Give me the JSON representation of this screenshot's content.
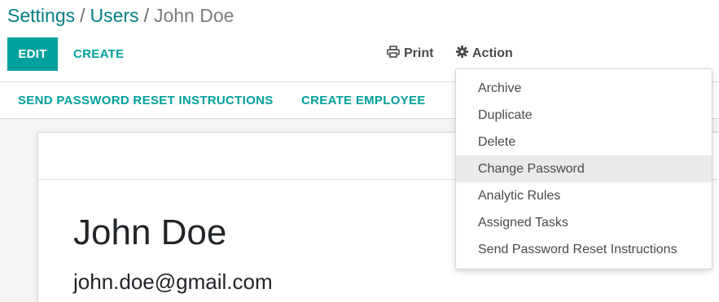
{
  "breadcrumb": {
    "items": [
      "Settings",
      "Users"
    ],
    "separator": "/",
    "current": "John Doe"
  },
  "toolbar": {
    "edit_label": "EDIT",
    "create_label": "CREATE",
    "print_label": "Print",
    "action_label": "Action"
  },
  "statusbar": {
    "buttons": [
      "SEND PASSWORD RESET INSTRUCTIONS",
      "CREATE EMPLOYEE"
    ]
  },
  "action_menu": {
    "items": [
      "Archive",
      "Duplicate",
      "Delete",
      "Change Password",
      "Analytic Rules",
      "Assigned Tasks",
      "Send Password Reset Instructions"
    ],
    "highlighted": "Change Password"
  },
  "form": {
    "name": "John Doe",
    "email": "john.doe@gmail.com"
  },
  "colors": {
    "primary": "#00a09d",
    "link": "#017e84",
    "text": "#212529",
    "muted": "#7c7c7c"
  },
  "icons": {
    "print": "printer-icon",
    "action": "gear-icon"
  }
}
